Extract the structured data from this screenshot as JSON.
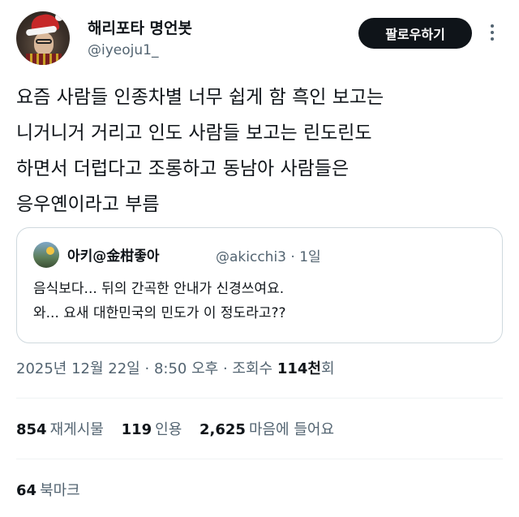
{
  "author": {
    "display_name": "해리포타 명언봇",
    "handle": "@iyeoju1_",
    "follow_label": "팔로우하기",
    "more_icon": "more-vertical-icon"
  },
  "tweet": {
    "lines": [
      "요즘 사람들 인종차별 너무 쉽게 함 흑인 보고는",
      "니거니거 거리고 인도 사람들 보고는 린도린도",
      "하면서 더럽다고 조롱하고 동남아 사람들은",
      "응우옌이라고 부름"
    ]
  },
  "quote": {
    "display_name": "아키@金柑좋아",
    "handle": "@akicchi3",
    "separator": "·",
    "age": "1일",
    "lines": [
      "음식보다... 뒤의 간곡한 안내가 신경쓰여요.",
      "와... 요새 대한민국의 민도가 이 정도라고??"
    ]
  },
  "meta": {
    "date": "2025년 12월 22일",
    "separator": "·",
    "time": "8:50 오후",
    "views_label": "조회수",
    "views_num": "114천",
    "views_suffix": "회"
  },
  "stats": {
    "reposts_num": "854",
    "reposts_label": "재게시물",
    "quotes_num": "119",
    "quotes_label": "인용",
    "likes_num": "2,625",
    "likes_label": "마음에 들어요",
    "bookmarks_num": "64",
    "bookmarks_label": "북마크"
  },
  "colors": {
    "text_primary": "#0f1419",
    "text_secondary": "#536471",
    "border": "#cfd9de",
    "button_bg": "#0f1419"
  }
}
